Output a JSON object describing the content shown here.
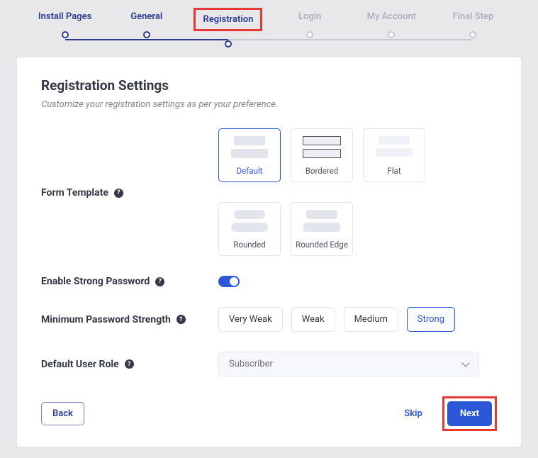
{
  "stepper": {
    "items": [
      {
        "label": "Install Pages",
        "state": "done"
      },
      {
        "label": "General",
        "state": "done"
      },
      {
        "label": "Registration",
        "state": "active"
      },
      {
        "label": "Login",
        "state": "pending"
      },
      {
        "label": "My Account",
        "state": "pending"
      },
      {
        "label": "Final Step",
        "state": "pending"
      }
    ]
  },
  "page": {
    "title": "Registration Settings",
    "subtitle": "Customize your registration settings as per your preference."
  },
  "form_template": {
    "label": "Form Template",
    "options": [
      {
        "label": "Default",
        "selected": true
      },
      {
        "label": "Bordered",
        "selected": false
      },
      {
        "label": "Flat",
        "selected": false
      },
      {
        "label": "Rounded",
        "selected": false
      },
      {
        "label": "Rounded Edge",
        "selected": false
      }
    ]
  },
  "strong_password": {
    "label": "Enable Strong Password",
    "enabled": true
  },
  "min_strength": {
    "label": "Minimum Password Strength",
    "options": [
      {
        "label": "Very Weak",
        "selected": false
      },
      {
        "label": "Weak",
        "selected": false
      },
      {
        "label": "Medium",
        "selected": false
      },
      {
        "label": "Strong",
        "selected": true
      }
    ]
  },
  "default_role": {
    "label": "Default User Role",
    "value": "Subscriber"
  },
  "footer": {
    "back": "Back",
    "skip": "Skip",
    "next": "Next"
  }
}
